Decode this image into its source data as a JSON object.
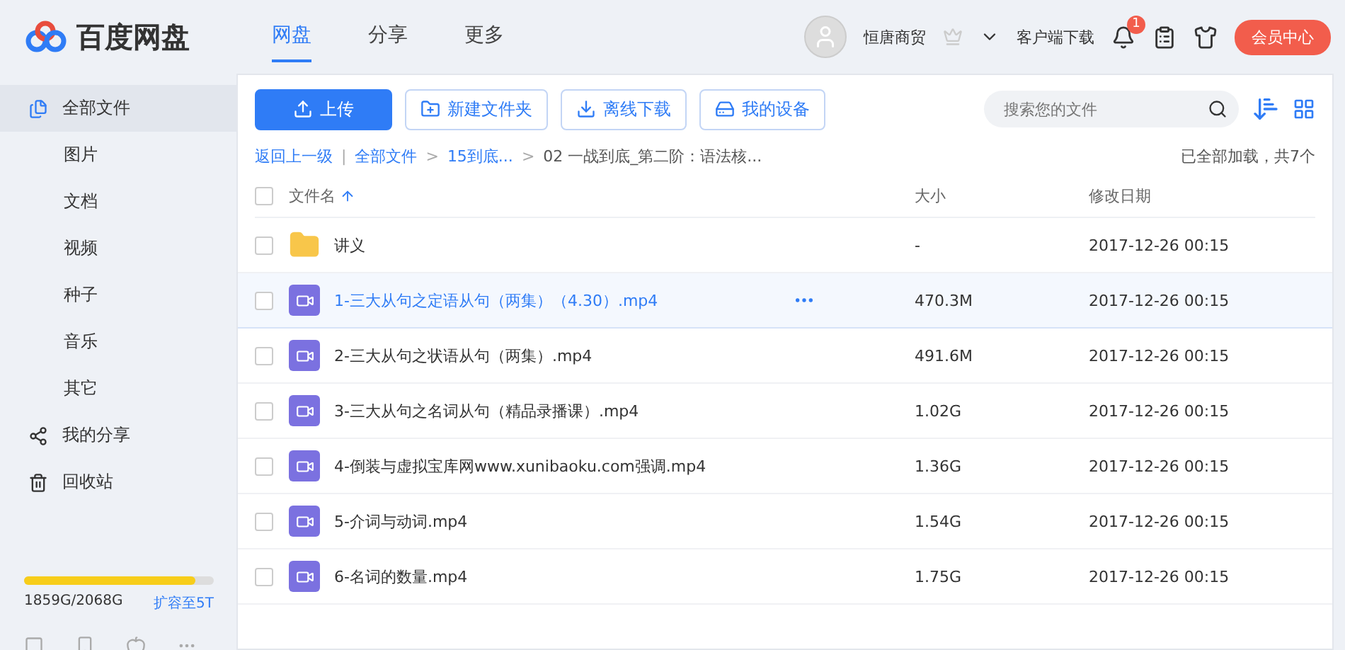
{
  "logo": {
    "text": "百度网盘"
  },
  "nav": [
    {
      "label": "网盘",
      "selected": true
    },
    {
      "label": "分享",
      "selected": false
    },
    {
      "label": "更多",
      "selected": false
    }
  ],
  "user": {
    "name": "恒唐商贸"
  },
  "client_download": "客户端下载",
  "notifications": {
    "count": "1"
  },
  "vip_button": "会员中心",
  "sidebar": {
    "items": [
      {
        "label": "全部文件",
        "kind": "top",
        "selected": true
      },
      {
        "label": "图片",
        "kind": "sub",
        "selected": false
      },
      {
        "label": "文档",
        "kind": "sub",
        "selected": false
      },
      {
        "label": "视频",
        "kind": "sub",
        "selected": false
      },
      {
        "label": "种子",
        "kind": "sub",
        "selected": false
      },
      {
        "label": "音乐",
        "kind": "sub",
        "selected": false
      },
      {
        "label": "其它",
        "kind": "sub",
        "selected": false
      },
      {
        "label": "我的分享",
        "kind": "share",
        "selected": false
      },
      {
        "label": "回收站",
        "kind": "trash",
        "selected": false
      }
    ],
    "storage": {
      "level": 0.9,
      "usage": "1859G/2068G",
      "upgrade": "扩容至5T"
    }
  },
  "toolbar": [
    {
      "label": "上传",
      "kind": "upload"
    },
    {
      "label": "新建文件夹",
      "kind": "folder"
    },
    {
      "label": "离线下载",
      "kind": "download"
    },
    {
      "label": "我的设备",
      "kind": "device"
    }
  ],
  "search": {
    "placeholder": "搜索您的文件"
  },
  "breadcrumb": [
    "返回上一级",
    "全部文件",
    "15到底...",
    "02 一战到底_第二阶：语法核..."
  ],
  "breadcrumb_separators": [
    "|",
    ">",
    ">"
  ],
  "load_status": "已全部加载，共7个",
  "table": {
    "select_all": {
      "checked": false
    },
    "columns": [
      "文件名",
      "大小",
      "修改日期"
    ],
    "rows": [
      {
        "kind": "folder",
        "name": "讲义",
        "size": "-",
        "date": "2017-12-26 00:15",
        "hovered": false,
        "checked": false
      },
      {
        "kind": "video",
        "name": "1-三大从句之定语从句（两集）（4.30）.mp4",
        "size": "470.3M",
        "date": "2017-12-26 00:15",
        "hovered": true,
        "checked": false
      },
      {
        "kind": "video",
        "name": "2-三大从句之状语从句（两集）.mp4",
        "size": "491.6M",
        "date": "2017-12-26 00:15",
        "hovered": false,
        "checked": false
      },
      {
        "kind": "video",
        "name": "3-三大从句之名词从句（精品录播课）.mp4",
        "size": "1.02G",
        "date": "2017-12-26 00:15",
        "hovered": false,
        "checked": false
      },
      {
        "kind": "video",
        "name": "4-倒装与虚拟宝库网www.xunibaoku.com强调.mp4",
        "size": "1.36G",
        "date": "2017-12-26 00:15",
        "hovered": false,
        "checked": false
      },
      {
        "kind": "video",
        "name": "5-介词与动词.mp4",
        "size": "1.54G",
        "date": "2017-12-26 00:15",
        "hovered": false,
        "checked": false
      },
      {
        "kind": "video",
        "name": "6-名词的数量.mp4",
        "size": "1.75G",
        "date": "2017-12-26 00:15",
        "hovered": false,
        "checked": false
      }
    ]
  }
}
